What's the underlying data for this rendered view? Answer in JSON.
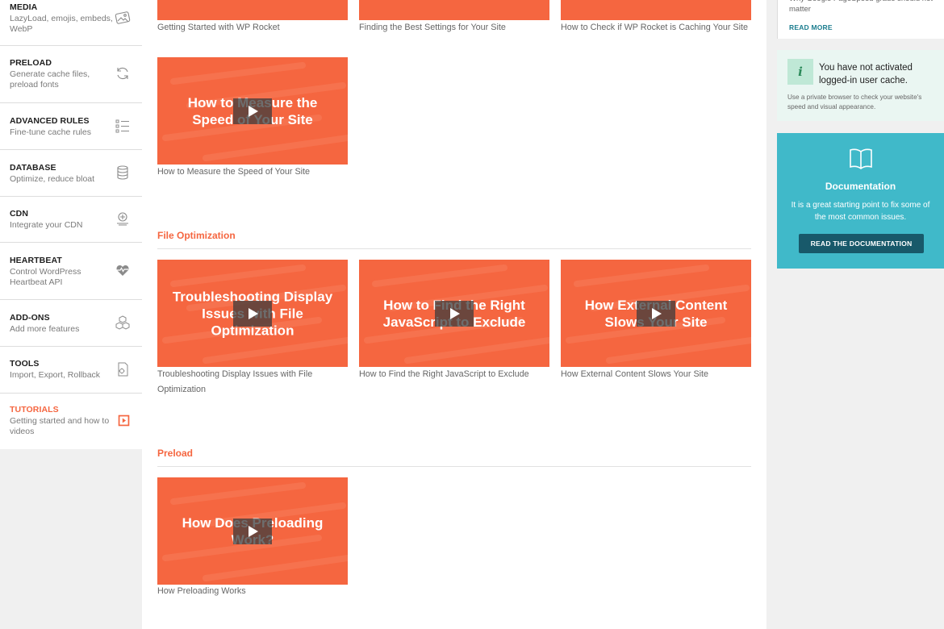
{
  "sidebar": {
    "items": [
      {
        "title": "MEDIA",
        "desc": "LazyLoad, emojis, embeds, WebP",
        "icon": "image-icon"
      },
      {
        "title": "PRELOAD",
        "desc": "Generate cache files, preload fonts",
        "icon": "refresh-icon"
      },
      {
        "title": "ADVANCED RULES",
        "desc": "Fine-tune cache rules",
        "icon": "list-icon"
      },
      {
        "title": "DATABASE",
        "desc": "Optimize, reduce bloat",
        "icon": "database-icon"
      },
      {
        "title": "CDN",
        "desc": "Integrate your CDN",
        "icon": "cdn-icon"
      },
      {
        "title": "HEARTBEAT",
        "desc": "Control WordPress Heartbeat API",
        "icon": "heartbeat-icon"
      },
      {
        "title": "ADD-ONS",
        "desc": "Add more features",
        "icon": "addons-icon"
      },
      {
        "title": "TOOLS",
        "desc": "Import, Export, Rollback",
        "icon": "tools-icon"
      },
      {
        "title": "TUTORIALS",
        "desc": "Getting started and how to videos",
        "icon": "video-icon"
      }
    ]
  },
  "main": {
    "top_captions": [
      "Getting Started with WP Rocket",
      "Finding the Best Settings for Your Site",
      "How to Check if WP Rocket is Caching Your Site"
    ],
    "measure": {
      "thumb_text": "How to Measure the Speed of Your Site",
      "caption": "How to Measure the Speed of Your Site"
    },
    "file_optimization": {
      "title": "File Optimization",
      "videos": [
        {
          "thumb_text": "Troubleshooting Display Issues with File Optimization",
          "caption": "Troubleshooting Display Issues with File Optimization"
        },
        {
          "thumb_text": "How to Find the Right JavaScript to Exclude",
          "caption": "How to Find the Right JavaScript to Exclude"
        },
        {
          "thumb_text": "How External Content Slows Your Site",
          "caption": "How External Content Slows Your Site"
        }
      ]
    },
    "preload": {
      "title": "Preload",
      "videos": [
        {
          "thumb_text": "How Does Preloading Work?",
          "caption": "How Preloading Works"
        }
      ]
    }
  },
  "right": {
    "card1": {
      "partial_text": "Why Google PageSpeed grade should not matter",
      "read_more": "READ MORE"
    },
    "notice": {
      "title": "You have not activated logged-in user cache.",
      "sub": "Use a private browser to check your website's speed and visual appearance.",
      "icon_char": "i"
    },
    "doc": {
      "title": "Documentation",
      "sub": "It is a great starting point to fix some of the most common issues.",
      "button": "READ THE DOCUMENTATION"
    }
  },
  "colors": {
    "accent": "#f56640",
    "teal": "#40b9c9",
    "dark_teal": "#18596a"
  }
}
